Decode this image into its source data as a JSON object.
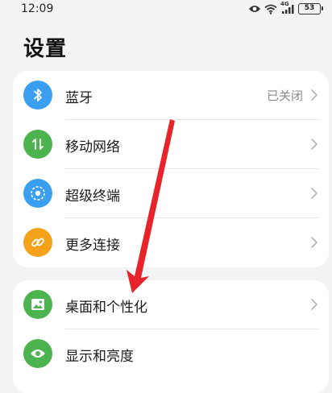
{
  "status_bar": {
    "time": "12:09",
    "network_label": "4G",
    "battery": "53"
  },
  "page": {
    "title": "设置"
  },
  "group1": {
    "items": [
      {
        "label": "蓝牙",
        "value": "已关闭",
        "icon": "bluetooth-icon",
        "color": "#3b9ff0"
      },
      {
        "label": "移动网络",
        "value": "",
        "icon": "mobile-data-icon",
        "color": "#4cb34f"
      },
      {
        "label": "超级终端",
        "value": "",
        "icon": "super-device-icon",
        "color": "#3b9ff0"
      },
      {
        "label": "更多连接",
        "value": "",
        "icon": "link-icon",
        "color": "#f5a21b"
      }
    ]
  },
  "group2": {
    "items": [
      {
        "label": "桌面和个性化",
        "icon": "wallpaper-icon",
        "color": "#4cb34f"
      },
      {
        "label": "显示和亮度",
        "icon": "eye-icon",
        "color": "#4cb34f"
      }
    ]
  },
  "annotation": {
    "color": "#e8242b"
  }
}
